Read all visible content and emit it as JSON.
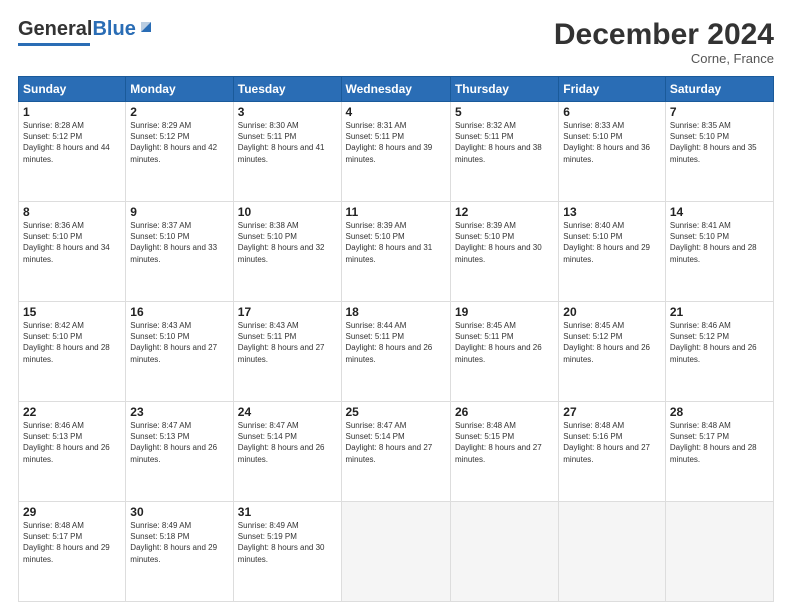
{
  "header": {
    "logo_general": "General",
    "logo_blue": "Blue",
    "month_title": "December 2024",
    "location": "Corne, France"
  },
  "days_of_week": [
    "Sunday",
    "Monday",
    "Tuesday",
    "Wednesday",
    "Thursday",
    "Friday",
    "Saturday"
  ],
  "weeks": [
    [
      {
        "day": "1",
        "sunrise": "Sunrise: 8:28 AM",
        "sunset": "Sunset: 5:12 PM",
        "daylight": "Daylight: 8 hours and 44 minutes."
      },
      {
        "day": "2",
        "sunrise": "Sunrise: 8:29 AM",
        "sunset": "Sunset: 5:12 PM",
        "daylight": "Daylight: 8 hours and 42 minutes."
      },
      {
        "day": "3",
        "sunrise": "Sunrise: 8:30 AM",
        "sunset": "Sunset: 5:11 PM",
        "daylight": "Daylight: 8 hours and 41 minutes."
      },
      {
        "day": "4",
        "sunrise": "Sunrise: 8:31 AM",
        "sunset": "Sunset: 5:11 PM",
        "daylight": "Daylight: 8 hours and 39 minutes."
      },
      {
        "day": "5",
        "sunrise": "Sunrise: 8:32 AM",
        "sunset": "Sunset: 5:11 PM",
        "daylight": "Daylight: 8 hours and 38 minutes."
      },
      {
        "day": "6",
        "sunrise": "Sunrise: 8:33 AM",
        "sunset": "Sunset: 5:10 PM",
        "daylight": "Daylight: 8 hours and 36 minutes."
      },
      {
        "day": "7",
        "sunrise": "Sunrise: 8:35 AM",
        "sunset": "Sunset: 5:10 PM",
        "daylight": "Daylight: 8 hours and 35 minutes."
      }
    ],
    [
      {
        "day": "8",
        "sunrise": "Sunrise: 8:36 AM",
        "sunset": "Sunset: 5:10 PM",
        "daylight": "Daylight: 8 hours and 34 minutes."
      },
      {
        "day": "9",
        "sunrise": "Sunrise: 8:37 AM",
        "sunset": "Sunset: 5:10 PM",
        "daylight": "Daylight: 8 hours and 33 minutes."
      },
      {
        "day": "10",
        "sunrise": "Sunrise: 8:38 AM",
        "sunset": "Sunset: 5:10 PM",
        "daylight": "Daylight: 8 hours and 32 minutes."
      },
      {
        "day": "11",
        "sunrise": "Sunrise: 8:39 AM",
        "sunset": "Sunset: 5:10 PM",
        "daylight": "Daylight: 8 hours and 31 minutes."
      },
      {
        "day": "12",
        "sunrise": "Sunrise: 8:39 AM",
        "sunset": "Sunset: 5:10 PM",
        "daylight": "Daylight: 8 hours and 30 minutes."
      },
      {
        "day": "13",
        "sunrise": "Sunrise: 8:40 AM",
        "sunset": "Sunset: 5:10 PM",
        "daylight": "Daylight: 8 hours and 29 minutes."
      },
      {
        "day": "14",
        "sunrise": "Sunrise: 8:41 AM",
        "sunset": "Sunset: 5:10 PM",
        "daylight": "Daylight: 8 hours and 28 minutes."
      }
    ],
    [
      {
        "day": "15",
        "sunrise": "Sunrise: 8:42 AM",
        "sunset": "Sunset: 5:10 PM",
        "daylight": "Daylight: 8 hours and 28 minutes."
      },
      {
        "day": "16",
        "sunrise": "Sunrise: 8:43 AM",
        "sunset": "Sunset: 5:10 PM",
        "daylight": "Daylight: 8 hours and 27 minutes."
      },
      {
        "day": "17",
        "sunrise": "Sunrise: 8:43 AM",
        "sunset": "Sunset: 5:11 PM",
        "daylight": "Daylight: 8 hours and 27 minutes."
      },
      {
        "day": "18",
        "sunrise": "Sunrise: 8:44 AM",
        "sunset": "Sunset: 5:11 PM",
        "daylight": "Daylight: 8 hours and 26 minutes."
      },
      {
        "day": "19",
        "sunrise": "Sunrise: 8:45 AM",
        "sunset": "Sunset: 5:11 PM",
        "daylight": "Daylight: 8 hours and 26 minutes."
      },
      {
        "day": "20",
        "sunrise": "Sunrise: 8:45 AM",
        "sunset": "Sunset: 5:12 PM",
        "daylight": "Daylight: 8 hours and 26 minutes."
      },
      {
        "day": "21",
        "sunrise": "Sunrise: 8:46 AM",
        "sunset": "Sunset: 5:12 PM",
        "daylight": "Daylight: 8 hours and 26 minutes."
      }
    ],
    [
      {
        "day": "22",
        "sunrise": "Sunrise: 8:46 AM",
        "sunset": "Sunset: 5:13 PM",
        "daylight": "Daylight: 8 hours and 26 minutes."
      },
      {
        "day": "23",
        "sunrise": "Sunrise: 8:47 AM",
        "sunset": "Sunset: 5:13 PM",
        "daylight": "Daylight: 8 hours and 26 minutes."
      },
      {
        "day": "24",
        "sunrise": "Sunrise: 8:47 AM",
        "sunset": "Sunset: 5:14 PM",
        "daylight": "Daylight: 8 hours and 26 minutes."
      },
      {
        "day": "25",
        "sunrise": "Sunrise: 8:47 AM",
        "sunset": "Sunset: 5:14 PM",
        "daylight": "Daylight: 8 hours and 27 minutes."
      },
      {
        "day": "26",
        "sunrise": "Sunrise: 8:48 AM",
        "sunset": "Sunset: 5:15 PM",
        "daylight": "Daylight: 8 hours and 27 minutes."
      },
      {
        "day": "27",
        "sunrise": "Sunrise: 8:48 AM",
        "sunset": "Sunset: 5:16 PM",
        "daylight": "Daylight: 8 hours and 27 minutes."
      },
      {
        "day": "28",
        "sunrise": "Sunrise: 8:48 AM",
        "sunset": "Sunset: 5:17 PM",
        "daylight": "Daylight: 8 hours and 28 minutes."
      }
    ],
    [
      {
        "day": "29",
        "sunrise": "Sunrise: 8:48 AM",
        "sunset": "Sunset: 5:17 PM",
        "daylight": "Daylight: 8 hours and 29 minutes."
      },
      {
        "day": "30",
        "sunrise": "Sunrise: 8:49 AM",
        "sunset": "Sunset: 5:18 PM",
        "daylight": "Daylight: 8 hours and 29 minutes."
      },
      {
        "day": "31",
        "sunrise": "Sunrise: 8:49 AM",
        "sunset": "Sunset: 5:19 PM",
        "daylight": "Daylight: 8 hours and 30 minutes."
      },
      null,
      null,
      null,
      null
    ]
  ]
}
